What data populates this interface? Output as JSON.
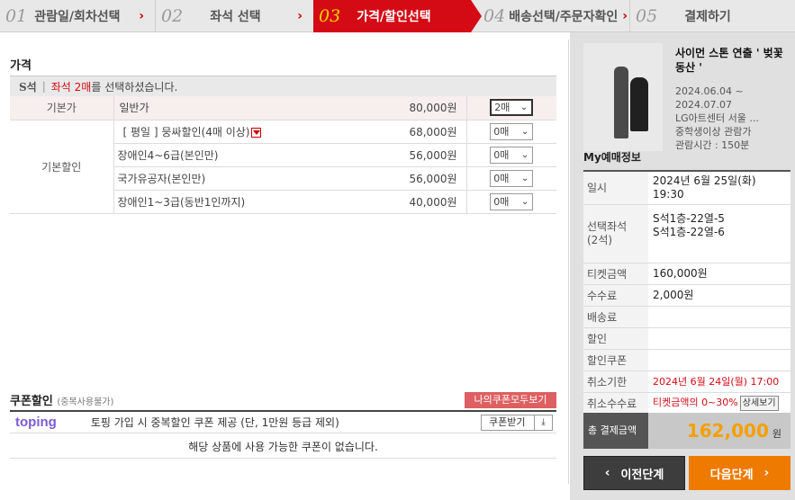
{
  "steps": [
    {
      "num": "01",
      "label": "관람일/회차선택",
      "arrow": "›"
    },
    {
      "num": "02",
      "label": "좌석 선택",
      "arrow": "›"
    },
    {
      "num": "03",
      "label": "가격/할인선택"
    },
    {
      "num": "04",
      "label": "배송선택/주문자확인",
      "arrow": "›"
    },
    {
      "num": "05",
      "label": "결제하기"
    }
  ],
  "price": {
    "title": "가격",
    "grade": "S석",
    "grade_sep": "|",
    "grade_count": "좌석 2매",
    "grade_msg": "를 선택하셨습니다.",
    "rows": [
      {
        "category": "기본가",
        "name": "일반가",
        "price": "80,000원",
        "qty": "2매"
      },
      {
        "category": "기본할인",
        "name": "[ 평일 ] 뭉싸할인(4매 이상)",
        "price": "68,000원",
        "qty": "0매"
      },
      {
        "name": "장애인4~6급(본인만)",
        "price": "56,000원",
        "qty": "0매"
      },
      {
        "name": "국가유공자(본인만)",
        "price": "56,000원",
        "qty": "0매"
      },
      {
        "name": "장애인1~3급(동반1인까지)",
        "price": "40,000원",
        "qty": "0매"
      }
    ]
  },
  "coupon": {
    "title": "쿠폰할인",
    "subtitle": "(중복사용불가)",
    "my_coupons": "나의쿠폰모두보기",
    "brand": "toping",
    "desc": "토핑 가입 시 중복할인 쿠폰 제공 (단, 1만원 등급 제외)",
    "get_label": "쿠폰받기",
    "none_msg": "해당 상품에 사용 가능한 쿠폰이 없습니다."
  },
  "show": {
    "title": "사이먼 스톤 연출 ' 벚꽃 동산 '",
    "dates": "2024.06.04 ~\n2024.07.07",
    "venue": "LG아트센터 서울 ...",
    "age": "중학생이상 관람가",
    "runtime": "관람시간 : 150분"
  },
  "my": {
    "title": "My예매정보",
    "date_k": "일시",
    "date_v": "2024년 6월 25일(화)",
    "time_v": "19:30",
    "seat_k": "선택좌석\n(2석)",
    "seat_1": "S석1층-22열-5",
    "seat_2": "S석1층-22열-6",
    "ticket_k": "티켓금액",
    "ticket_v": "160,000원",
    "fee_k": "수수료",
    "fee_v": "2,000원",
    "delivery_k": "배송료",
    "discount_k": "할인",
    "coupon_k": "할인쿠폰",
    "cancel_k": "취소기한",
    "cancel_v": "2024년 6월 24일(월) 17:00",
    "cfee_k": "취소수수료",
    "cfee_v": "티켓금액의 0~30%",
    "detail": "상세보기",
    "total_k": "총 결제금액",
    "total_v": "162,000",
    "total_unit": "원"
  },
  "nav": {
    "prev": "이전단계",
    "next": "다음단계"
  },
  "colors": {
    "accent": "#d40a14",
    "next": "#ef7a00",
    "total": "#f5a000"
  }
}
